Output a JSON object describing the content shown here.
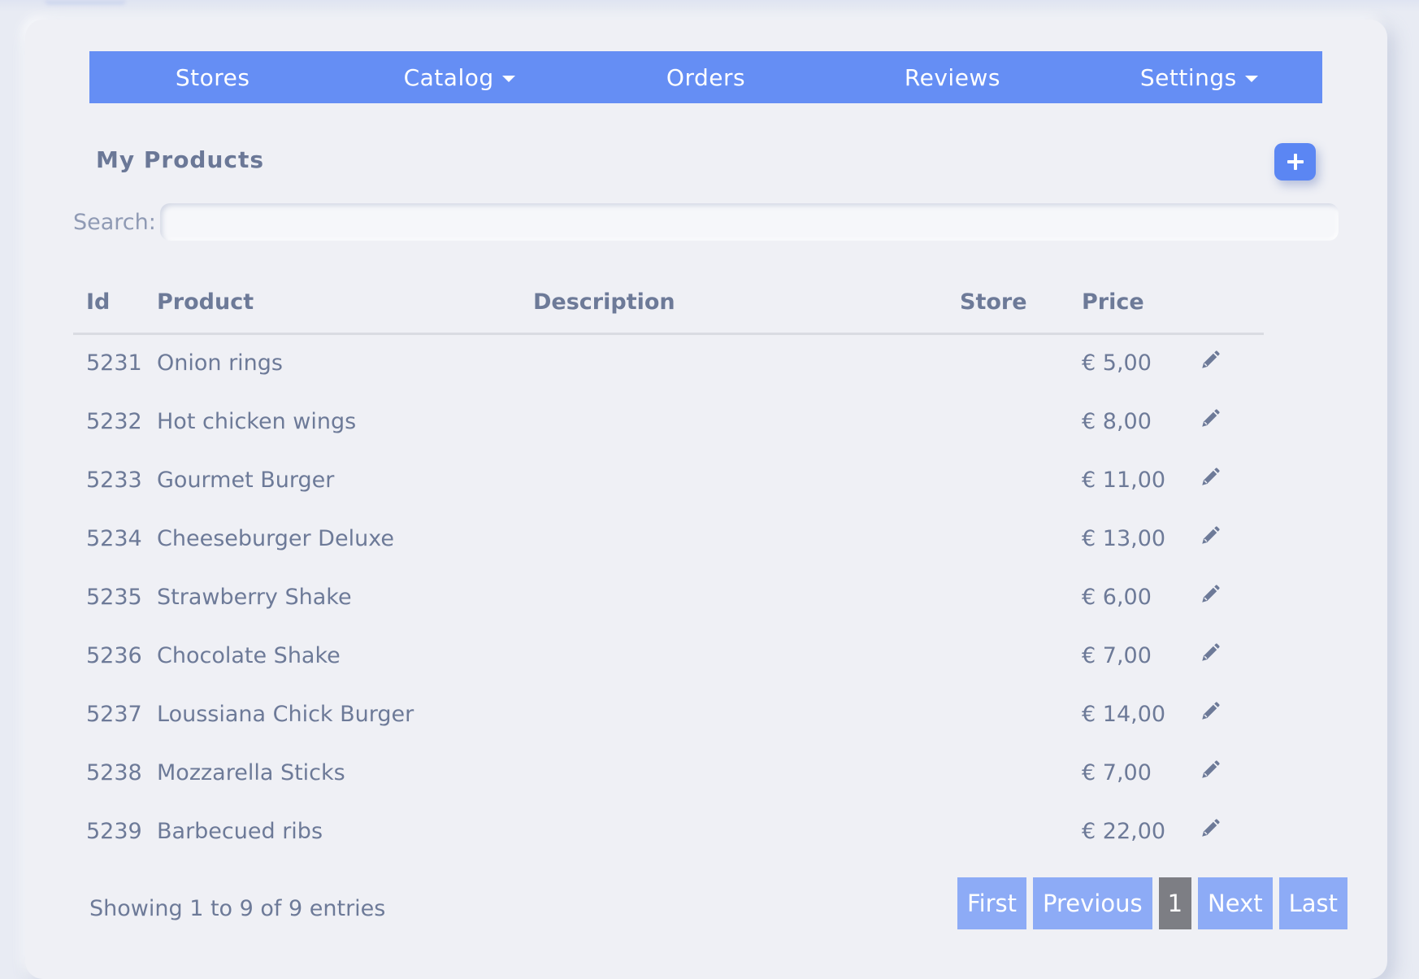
{
  "nav": {
    "items": [
      {
        "label": "Stores",
        "dropdown": false
      },
      {
        "label": "Catalog",
        "dropdown": true
      },
      {
        "label": "Orders",
        "dropdown": false
      },
      {
        "label": "Reviews",
        "dropdown": false
      },
      {
        "label": "Settings",
        "dropdown": true
      }
    ]
  },
  "page": {
    "title": "My Products",
    "add_icon": "plus-icon"
  },
  "search": {
    "label": "Search:",
    "value": ""
  },
  "table": {
    "columns": [
      "Id",
      "Product",
      "Description",
      "Store",
      "Price",
      ""
    ],
    "rows": [
      {
        "id": "5231",
        "product": "Onion rings",
        "description": "",
        "store": "",
        "price": "€ 5,00"
      },
      {
        "id": "5232",
        "product": "Hot chicken wings",
        "description": "",
        "store": "",
        "price": "€ 8,00"
      },
      {
        "id": "5233",
        "product": "Gourmet Burger",
        "description": "",
        "store": "",
        "price": "€ 11,00"
      },
      {
        "id": "5234",
        "product": "Cheeseburger Deluxe",
        "description": "",
        "store": "",
        "price": "€ 13,00"
      },
      {
        "id": "5235",
        "product": "Strawberry Shake",
        "description": "",
        "store": "",
        "price": "€ 6,00"
      },
      {
        "id": "5236",
        "product": "Chocolate Shake",
        "description": "",
        "store": "",
        "price": "€ 7,00"
      },
      {
        "id": "5237",
        "product": "Loussiana Chick Burger",
        "description": "",
        "store": "",
        "price": "€ 14,00"
      },
      {
        "id": "5238",
        "product": "Mozzarella Sticks",
        "description": "",
        "store": "",
        "price": "€ 7,00"
      },
      {
        "id": "5239",
        "product": "Barbecued ribs",
        "description": "",
        "store": "",
        "price": "€ 22,00"
      }
    ],
    "edit_icon": "pencil-icon"
  },
  "footer": {
    "info": "Showing 1 to 9 of 9 entries"
  },
  "pagination": {
    "first": "First",
    "previous": "Previous",
    "current": "1",
    "next": "Next",
    "last": "Last"
  },
  "colors": {
    "nav_bg": "#658ef4",
    "add_button": "#5b86f3",
    "page_button": "#8dabf6",
    "active_page": "#7d7e84",
    "text": "#6d7a98",
    "card_bg": "#eff0f5"
  }
}
